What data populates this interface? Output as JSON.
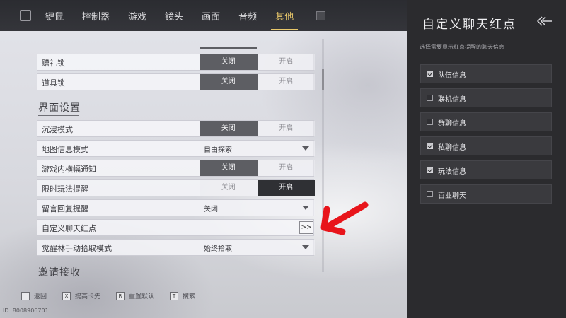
{
  "tabs": [
    {
      "label": "键鼠",
      "active": false
    },
    {
      "label": "控制器",
      "active": false
    },
    {
      "label": "游戏",
      "active": false
    },
    {
      "label": "镜头",
      "active": false
    },
    {
      "label": "画面",
      "active": false
    },
    {
      "label": "音频",
      "active": false
    },
    {
      "label": "其他",
      "active": true
    }
  ],
  "settings": {
    "gift_lock": {
      "label": "赠礼锁",
      "off": "关闭",
      "on": "开启",
      "selected": "off"
    },
    "item_lock": {
      "label": "道具锁",
      "off": "关闭",
      "on": "开启",
      "selected": "off"
    },
    "section_interface": "界面设置",
    "immersive": {
      "label": "沉浸模式",
      "off": "关闭",
      "on": "开启",
      "selected": "off"
    },
    "map_info": {
      "label": "地图信息模式",
      "value": "自由探索"
    },
    "banner": {
      "label": "游戏内横幅通知",
      "off": "关闭",
      "on": "开启",
      "selected": "off"
    },
    "timed_play": {
      "label": "限时玩法提醒",
      "off": "关闭",
      "on": "开启",
      "selected": "on"
    },
    "reply_remind": {
      "label": "留言回复提醒",
      "value": "关闭"
    },
    "custom_chat": {
      "label": "自定义聊天红点",
      "button": ">>"
    },
    "pickup": {
      "label": "觉醒林手动拾取模式",
      "value": "始终拾取"
    },
    "section_invite": "邀请接收"
  },
  "hints": [
    {
      "key": "",
      "label": "返回"
    },
    {
      "key": "X",
      "label": "提高卡先"
    },
    {
      "key": "R",
      "label": "重置默认"
    },
    {
      "key": "T",
      "label": "搜索"
    }
  ],
  "uid": "ID: 8008906701",
  "panel": {
    "title": "自定义聊天红点",
    "subtitle": "选择需要显示红点提醒的聊天信息",
    "items": [
      {
        "label": "队伍信息",
        "checked": true
      },
      {
        "label": "联机信息",
        "checked": false
      },
      {
        "label": "群聊信息",
        "checked": false
      },
      {
        "label": "私聊信息",
        "checked": true
      },
      {
        "label": "玩法信息",
        "checked": true
      },
      {
        "label": "百业聊天",
        "checked": false
      }
    ]
  }
}
